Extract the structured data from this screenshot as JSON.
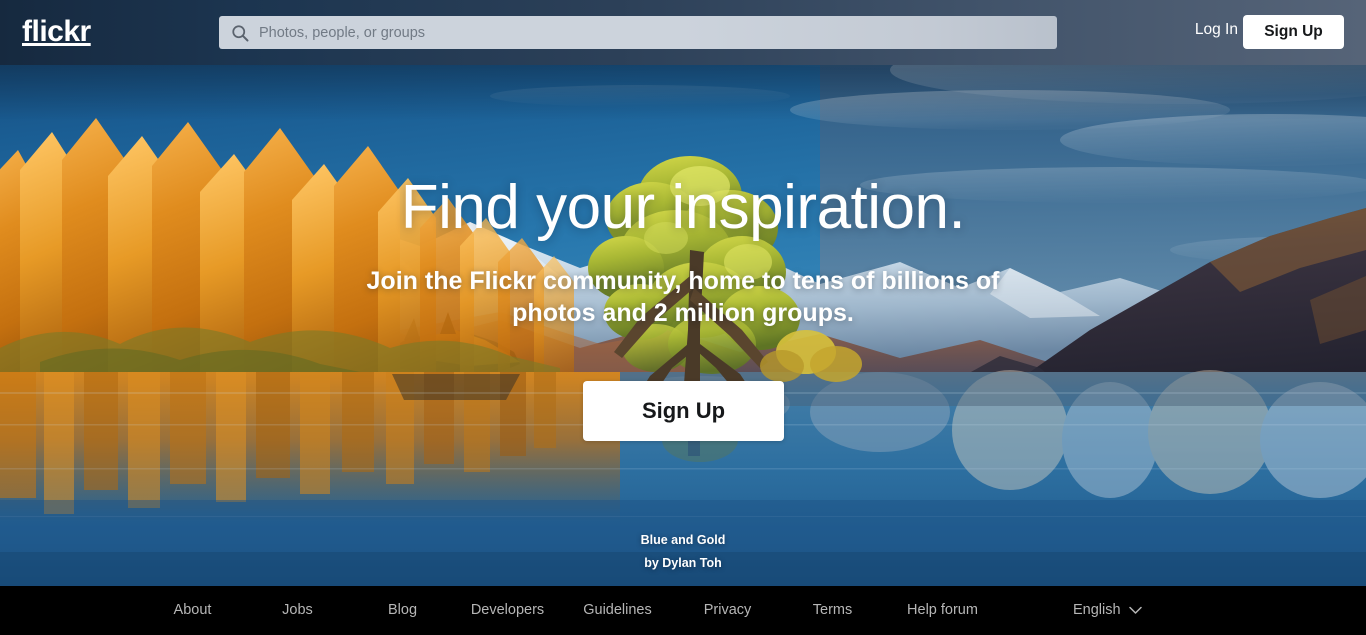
{
  "header": {
    "logo": "flickr",
    "search": {
      "placeholder": "Photos, people, or groups",
      "value": "",
      "icon": "search-icon"
    },
    "login_label": "Log In",
    "signup_label": "Sign Up"
  },
  "hero": {
    "headline": "Find your inspiration.",
    "subhead_line1": "Join the Flickr community, home to tens of billions of",
    "subhead_line2": "photos and 2 million groups.",
    "cta_label": "Sign Up",
    "credit_title": "Blue and Gold",
    "credit_author": "by Dylan Toh",
    "photo_description": "Golden poplar trees and a lone willow tree on a calm blue lake with snow-capped mountains at sunrise"
  },
  "footer": {
    "links": [
      {
        "label": "About"
      },
      {
        "label": "Jobs"
      },
      {
        "label": "Blog"
      },
      {
        "label": "Developers"
      },
      {
        "label": "Guidelines"
      },
      {
        "label": "Privacy"
      },
      {
        "label": "Terms"
      },
      {
        "label": "Help forum"
      }
    ],
    "language": {
      "label": "English",
      "icon": "chevron-down-icon"
    }
  },
  "colors": {
    "header_dark": "#16293f",
    "header_light": "#566478",
    "footer_bg": "#000000",
    "cta_bg": "#ffffff",
    "cta_text": "#16181a",
    "footer_link": "#b6b6b6",
    "search_bg": "#ccd3dc",
    "sky_blue": "#1f6ca6",
    "foliage_gold": "#d8821c",
    "water_blue": "#2a6d9e"
  }
}
